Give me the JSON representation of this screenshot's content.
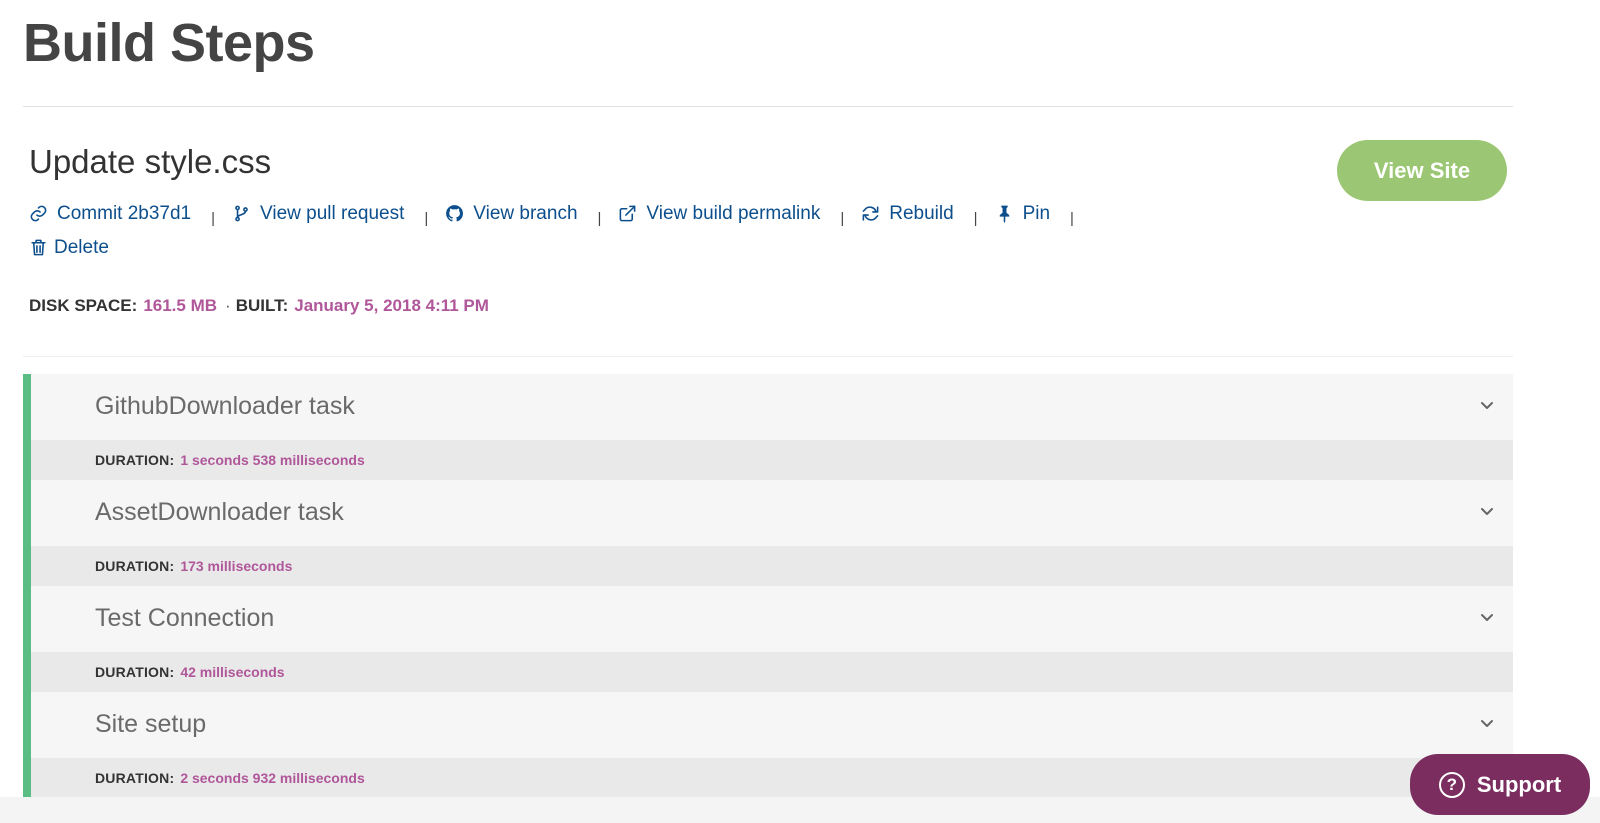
{
  "page": {
    "title": "Build Steps"
  },
  "build": {
    "title": "Update style.css",
    "view_site_label": "View Site",
    "actions": [
      {
        "label": "Commit 2b37d1",
        "icon": "link-icon"
      },
      {
        "label": "View pull request",
        "icon": "branch-icon"
      },
      {
        "label": "View branch",
        "icon": "github-icon"
      },
      {
        "label": "View build permalink",
        "icon": "external-link-icon"
      },
      {
        "label": "Rebuild",
        "icon": "refresh-icon"
      },
      {
        "label": "Pin",
        "icon": "pin-icon"
      },
      {
        "label": "Delete",
        "icon": "trash-icon"
      }
    ],
    "separator": "|",
    "disk_space_label": "DISK SPACE:",
    "disk_space_value": "161.5 MB",
    "meta_dot": "·",
    "built_label": "BUILT:",
    "built_value": "January 5, 2018 4:11 PM"
  },
  "steps": [
    {
      "name": "GithubDownloader task",
      "duration_label": "DURATION:",
      "duration": "1 seconds 538 milliseconds"
    },
    {
      "name": "AssetDownloader task",
      "duration_label": "DURATION:",
      "duration": "173 milliseconds"
    },
    {
      "name": "Test Connection",
      "duration_label": "DURATION:",
      "duration": "42 milliseconds"
    },
    {
      "name": "Site setup",
      "duration_label": "DURATION:",
      "duration": "2 seconds 932 milliseconds"
    }
  ],
  "support": {
    "label": "Support",
    "icon_glyph": "?"
  },
  "colors": {
    "accent_green": "#9bc774",
    "status_bar_green": "#5bbd84",
    "link_blue": "#0d4f8c",
    "value_magenta": "#b0579a",
    "support_purple": "#7a2d5e"
  }
}
